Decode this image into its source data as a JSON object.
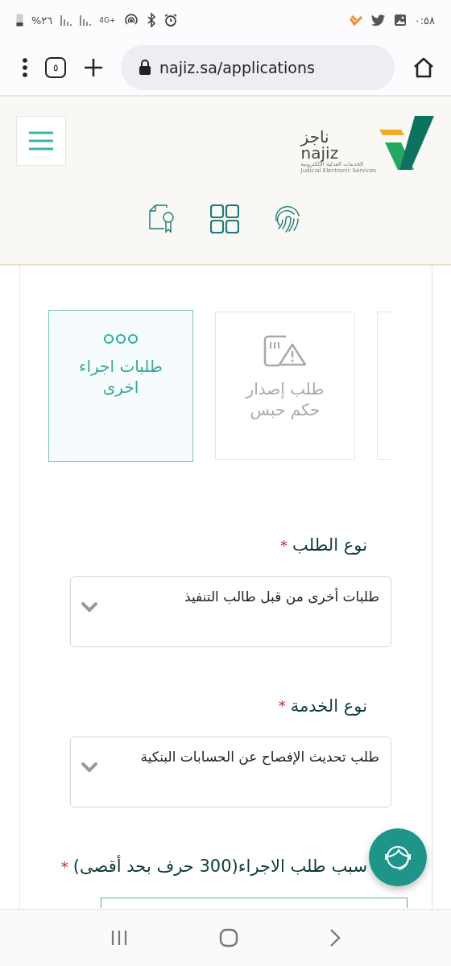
{
  "status_bar": {
    "time": "٠:٥٨",
    "battery": "%٢٦",
    "network": "4G+"
  },
  "browser": {
    "tab_count": "٥",
    "url": "najiz.sa/applications"
  },
  "site_header": {
    "logo": {
      "arabic": "ناجز",
      "latin": "najiz",
      "tagline_arabic": "الخدمات العدلية الإلكترونية",
      "tagline_latin": "Judicial Electronic Services"
    }
  },
  "service_cards": [
    {
      "kind": "cut-off"
    },
    {
      "kind": "warning",
      "label": "طلب إصدار حكم حبس",
      "selected": false
    },
    {
      "kind": "dots",
      "label": "طلبات اجراء اخرى",
      "selected": true
    }
  ],
  "form_fields": [
    {
      "kind": "select",
      "label": "نوع الطلب",
      "required_mark": "*",
      "value": "طلبات أخرى من قبل طالب التنفيذ"
    },
    {
      "kind": "select",
      "label": "نوع الخدمة",
      "required_mark": "*",
      "value": "طلب تحديث الإفصاح عن الحسابات البنكية"
    },
    {
      "kind": "textarea",
      "label": "سبب طلب الاجراء(300 حرف بحد أقصى)",
      "required_mark": "*"
    }
  ]
}
